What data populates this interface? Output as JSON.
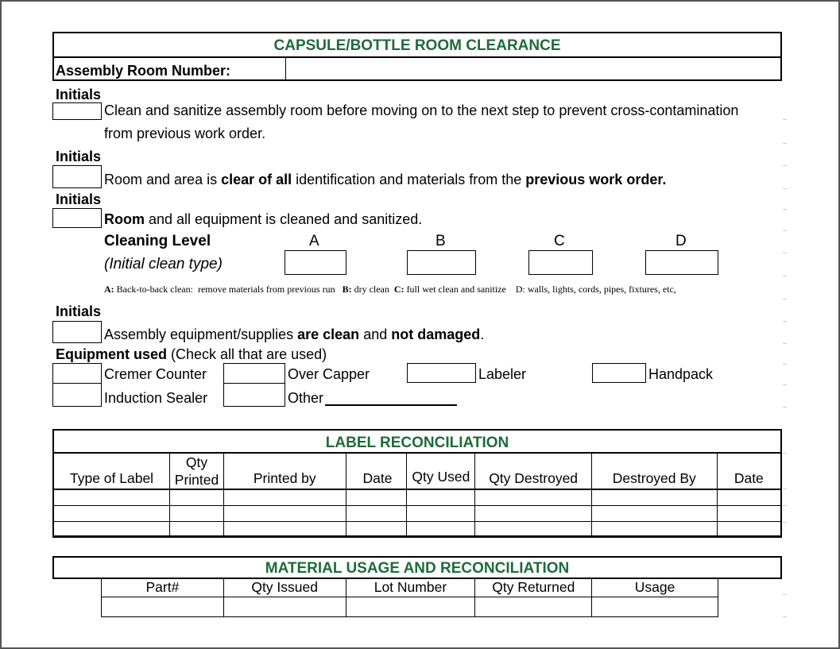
{
  "header": {
    "title": "CAPSULE/BOTTLE ROOM CLEARANCE",
    "assembly_room_label": "Assembly Room Number:",
    "assembly_room_value": ""
  },
  "steps": [
    {
      "initials_label": "Initials",
      "text_parts": [
        {
          "t": "Clean and sanitize assembly room before moving on to the next step to prevent cross-contamination",
          "b": false
        }
      ],
      "line2": "from previous work order."
    },
    {
      "initials_label": "Initials",
      "text_parts": [
        {
          "t": "Room and area is ",
          "b": false
        },
        {
          "t": "clear of all",
          "b": true
        },
        {
          "t": " identification and materials from the ",
          "b": false
        },
        {
          "t": "previous work order.",
          "b": true
        }
      ]
    },
    {
      "initials_label": "Initials",
      "text_parts": [
        {
          "t": "Room",
          "b": true
        },
        {
          "t": " and all equipment is cleaned and sanitized.",
          "b": false
        }
      ]
    },
    {
      "initials_label": "Initials",
      "text_parts": [
        {
          "t": "Assembly equipment/supplies ",
          "b": false
        },
        {
          "t": "are clean",
          "b": true
        },
        {
          "t": " and ",
          "b": false
        },
        {
          "t": "not damaged",
          "b": true
        },
        {
          "t": ".",
          "b": false
        }
      ]
    }
  ],
  "cleaning": {
    "label": "Cleaning Level",
    "sublabel": "(Initial clean type)",
    "levels": [
      "A",
      "B",
      "C",
      "D"
    ],
    "legend": [
      {
        "key": "A:",
        "text": " Back-to-back clean:  remove materials from previous run"
      },
      {
        "key": "B:",
        "text": " dry clean"
      },
      {
        "key": "C:",
        "text": " full wet clean and sanitize"
      },
      {
        "key": "",
        "text": "D: walls, lights, cords, pipes, fixtures, etc,"
      }
    ]
  },
  "equipment": {
    "label": "Equipment used",
    "hint": " (Check all that are used)",
    "items": [
      "Cremer Counter",
      "Over Capper",
      "Labeler",
      "Handpack",
      "Induction Sealer",
      "Other"
    ]
  },
  "label_reconciliation": {
    "title": "LABEL RECONCILIATION",
    "columns": [
      "Type of Label",
      "Qty Printed",
      "Printed by",
      "Date",
      "Qty Used",
      "Qty Destroyed",
      "Destroyed By",
      "Date"
    ],
    "rows": [
      [
        "",
        "",
        "",
        "",
        "",
        "",
        "",
        ""
      ],
      [
        "",
        "",
        "",
        "",
        "",
        "",
        "",
        ""
      ],
      [
        "",
        "",
        "",
        "",
        "",
        "",
        "",
        ""
      ]
    ]
  },
  "material_usage": {
    "title": "MATERIAL USAGE AND RECONCILIATION",
    "columns": [
      "Part#",
      "Qty Issued",
      "Lot Number",
      "Qty Returned",
      "Usage"
    ],
    "rows": [
      [
        "",
        "",
        "",
        "",
        ""
      ]
    ]
  }
}
